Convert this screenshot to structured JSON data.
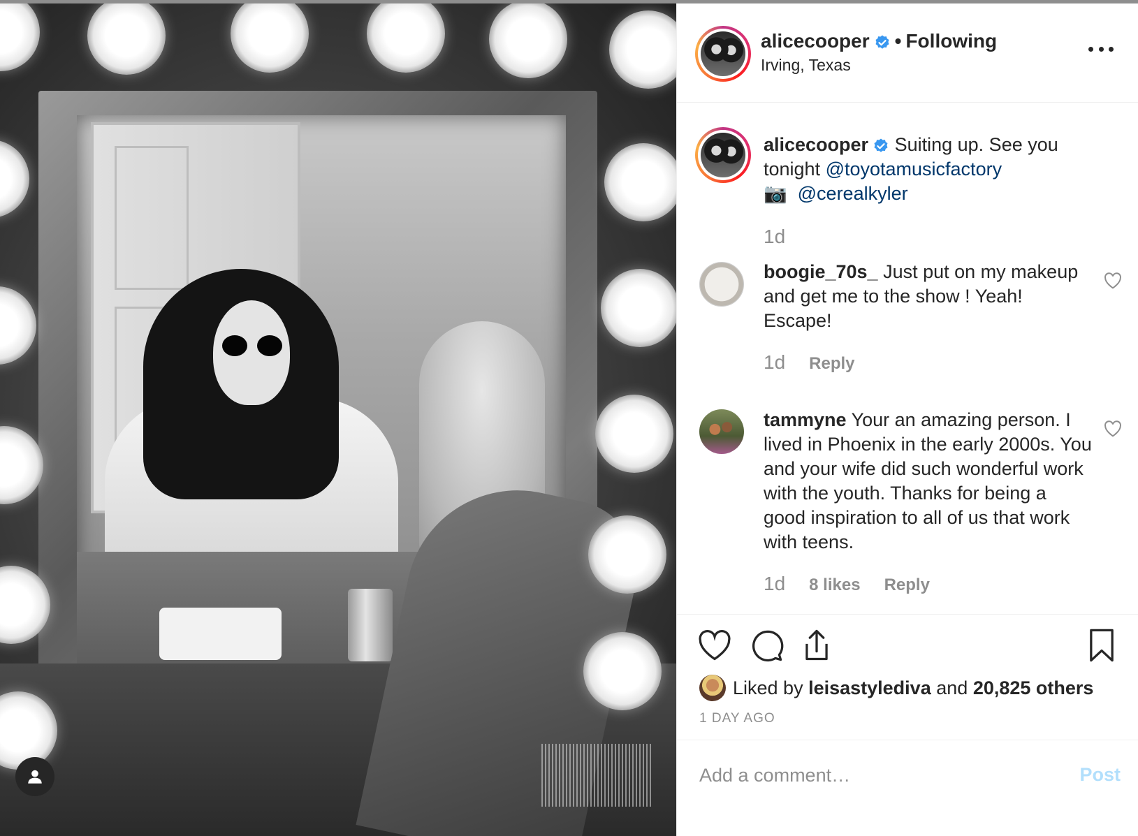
{
  "post": {
    "author": {
      "username": "alicecooper",
      "follow_status": "Following",
      "location": "Irving, Texas",
      "verified": true
    },
    "caption": {
      "username": "alicecooper",
      "text_before": "Suiting up. See you tonight ",
      "mention1": "@toyotamusicfactory",
      "camera_emoji": "📷",
      "mention2": "@cerealkyler",
      "time": "1d"
    },
    "comments": [
      {
        "username": "boogie_70s_",
        "text": "Just put on my makeup and get me to the show ! Yeah! Escape!",
        "time": "1d",
        "likes": "",
        "reply_label": "Reply"
      },
      {
        "username": "tammyne",
        "text": "Your an amazing person. I lived in Phoenix in the early 2000s. You and your wife did such wonderful work with the youth. Thanks for being a good inspiration to all of us that work with teens.",
        "time": "1d",
        "likes": "8 likes",
        "reply_label": "Reply"
      }
    ],
    "likes": {
      "prefix": "Liked by",
      "liker": "leisastylediva",
      "middle": "and",
      "others": "20,825 others"
    },
    "timestamp": "1 DAY AGO"
  },
  "add_comment": {
    "placeholder": "Add a comment…",
    "post_label": "Post"
  },
  "icons": [
    "heart-icon",
    "comment-icon",
    "share-icon",
    "bookmark-icon",
    "more-icon",
    "user-tag-icon",
    "verified-icon"
  ],
  "colors": {
    "accent": "#0095f6",
    "mention": "#00376b",
    "post_disabled": "#b2dffc",
    "verified": "#3897f0"
  }
}
